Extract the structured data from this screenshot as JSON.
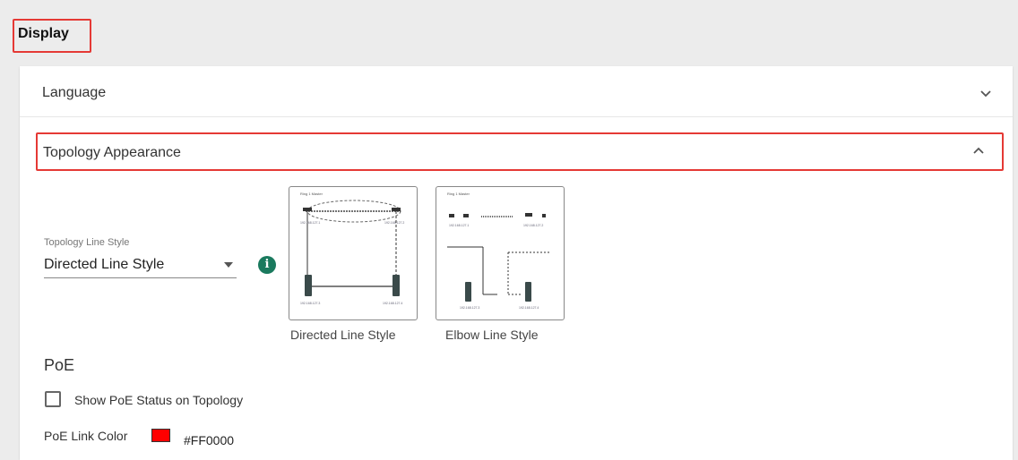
{
  "page": {
    "title": "Display"
  },
  "sections": {
    "language": {
      "label": "Language",
      "expanded": false,
      "icon": "chevron-down-icon"
    },
    "topology": {
      "label": "Topology Appearance",
      "expanded": true,
      "icon": "chevron-up-icon"
    }
  },
  "topology_line_style": {
    "caption": "Topology Line Style",
    "selected": "Directed Line Style",
    "info_icon": "i",
    "options": [
      {
        "label": "Directed Line Style",
        "preview": {
          "title": "Ring 1 Master",
          "node_labels": [
            "192.168.127.1",
            "192.168.127.2",
            "192.168.127.3",
            "192.168.127.4"
          ]
        }
      },
      {
        "label": "Elbow Line Style",
        "preview": {
          "title": "Ring 1 Master",
          "node_labels": [
            "192.168.127.1",
            "192.168.127.2",
            "192.168.127.3",
            "192.168.127.4"
          ]
        }
      }
    ]
  },
  "poe": {
    "heading": "PoE",
    "show_status_label": "Show PoE Status on Topology",
    "show_status_checked": false,
    "link_color_label": "PoE Link Color",
    "link_color": "#FF0000"
  },
  "colors": {
    "highlight": "#e53935",
    "info": "#1a7a5e",
    "background": "#ececec"
  }
}
